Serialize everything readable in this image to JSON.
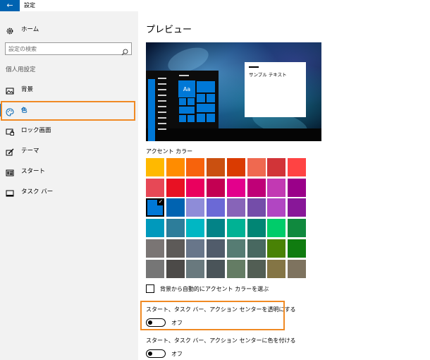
{
  "window": {
    "back_glyph": "←",
    "title": "設定"
  },
  "sidebar": {
    "home_label": "ホーム",
    "search_placeholder": "設定の検索",
    "section_title": "個人用設定",
    "items": [
      {
        "label": "背景",
        "icon": "picture-icon"
      },
      {
        "label": "色",
        "icon": "palette-icon",
        "active": true
      },
      {
        "label": "ロック画面",
        "icon": "lock-screen-icon"
      },
      {
        "label": "テーマ",
        "icon": "theme-brush-icon"
      },
      {
        "label": "スタート",
        "icon": "start-icon"
      },
      {
        "label": "タスク バー",
        "icon": "taskbar-icon"
      }
    ]
  },
  "main": {
    "title": "プレビュー",
    "preview": {
      "tile_label": "Aa",
      "sample_text": "サンプル テキスト"
    },
    "accent_label": "アクセント カラー",
    "swatch_rows": [
      [
        "#ffb900",
        "#ff8c00",
        "#f7630c",
        "#ca5010",
        "#da3b01",
        "#ef6950",
        "#d13438",
        "#ff4343"
      ],
      [
        "#e74856",
        "#e81123",
        "#ea005e",
        "#c30052",
        "#e3008c",
        "#bf0077",
        "#c239b3",
        "#9a0089"
      ],
      [
        "#0078d7",
        "#0063b1",
        "#8e8cd8",
        "#6b69d6",
        "#8764b8",
        "#744da9",
        "#b146c2",
        "#881798"
      ],
      [
        "#0099bc",
        "#2d7d9a",
        "#00b7c3",
        "#038387",
        "#00b294",
        "#018574",
        "#00cc6a",
        "#10893e"
      ],
      [
        "#7a7574",
        "#5d5a58",
        "#68768a",
        "#515c6b",
        "#567c73",
        "#486860",
        "#498205",
        "#107c10"
      ],
      [
        "#767676",
        "#4c4a48",
        "#69797e",
        "#4a5459",
        "#647c64",
        "#525e54",
        "#847545",
        "#7e735f"
      ]
    ],
    "selected_swatch": [
      2,
      0
    ],
    "auto_accent_label": "背景から自動的にアクセント カラーを選ぶ",
    "transparency": {
      "title": "スタート、タスク バー、アクション センターを透明にする",
      "state": "オフ"
    },
    "color_on_surfaces": {
      "title": "スタート、タスク バー、アクション センターに色を付ける",
      "state": "オフ"
    }
  }
}
